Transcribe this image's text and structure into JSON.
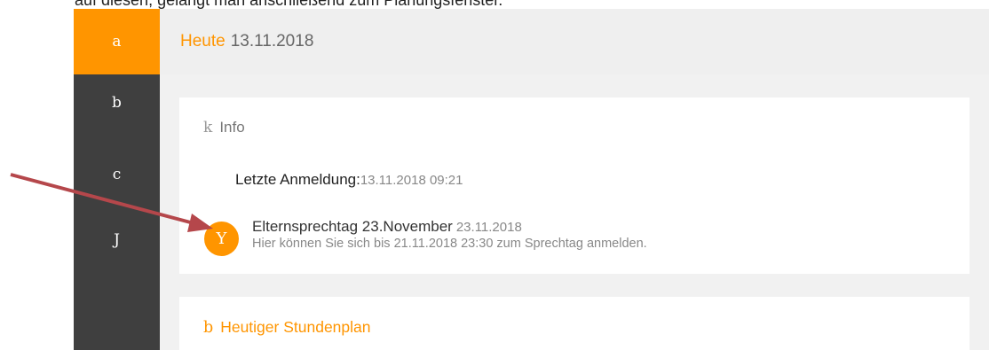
{
  "caption": "auf diesen, gelangt man anschließend zum Planungsfenster.",
  "sidebar": {
    "items": [
      {
        "label": "a",
        "active": true
      },
      {
        "label": "b"
      },
      {
        "label": "c"
      },
      {
        "label": "J"
      }
    ]
  },
  "header": {
    "today_label": "Heute",
    "date": "13.11.2018"
  },
  "info_card": {
    "icon_glyph": "k",
    "title": "Info",
    "last_login_label": "Letzte Anmeldung:",
    "last_login_value": "13.11.2018 09:21",
    "notice": {
      "badge_glyph": "Y",
      "title": "Elternsprechtag 23.November",
      "date": "23.11.2018",
      "description": "Hier können Sie sich bis 21.11.2018 23:30 zum Sprechtag anmelden."
    }
  },
  "plan_card": {
    "icon_glyph": "b",
    "title": "Heutiger Stundenplan"
  },
  "colors": {
    "accent": "#ff9500",
    "sidebar": "#3f3f3f",
    "arrow": "#b5474b"
  }
}
